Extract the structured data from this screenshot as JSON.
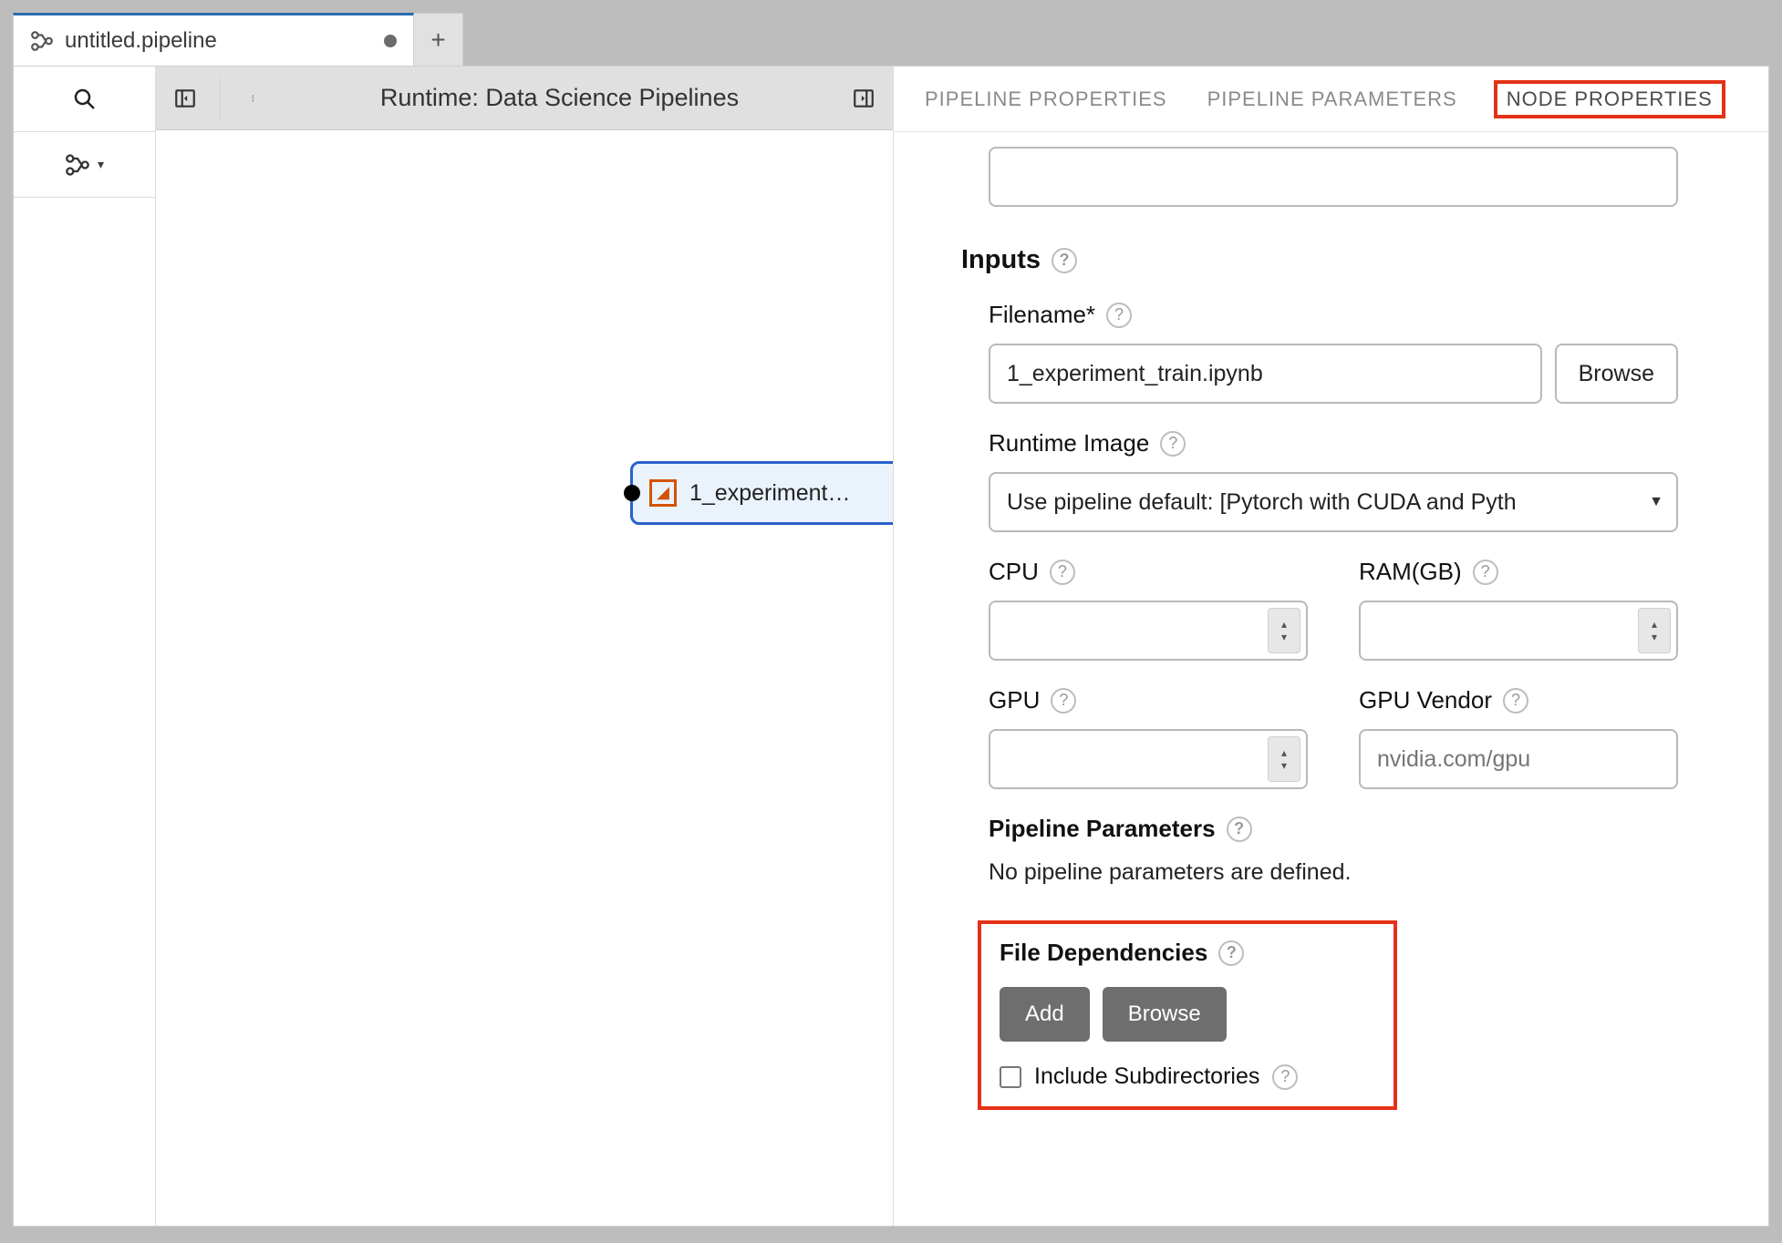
{
  "tab": {
    "title": "untitled.pipeline",
    "add_tooltip": "+"
  },
  "toolbar": {
    "runtime_label": "Runtime: Data Science Pipelines"
  },
  "canvas": {
    "node_label": "1_experiment…"
  },
  "tabs": {
    "pipeline_properties": "PIPELINE PROPERTIES",
    "pipeline_parameters": "PIPELINE PARAMETERS",
    "node_properties": "NODE PROPERTIES"
  },
  "props": {
    "inputs_heading": "Inputs",
    "filename_label": "Filename*",
    "filename_value": "1_experiment_train.ipynb",
    "browse_label": "Browse",
    "runtime_image_label": "Runtime Image",
    "runtime_image_value": "Use pipeline default: [Pytorch with CUDA and Pyth",
    "cpu_label": "CPU",
    "ram_label": "RAM(GB)",
    "gpu_label": "GPU",
    "gpu_vendor_label": "GPU Vendor",
    "gpu_vendor_placeholder": "nvidia.com/gpu",
    "pipeline_params_heading": "Pipeline Parameters",
    "no_params_text": "No pipeline parameters are defined.",
    "file_deps_heading": "File Dependencies",
    "add_label": "Add",
    "include_subdirs_label": "Include Subdirectories"
  }
}
